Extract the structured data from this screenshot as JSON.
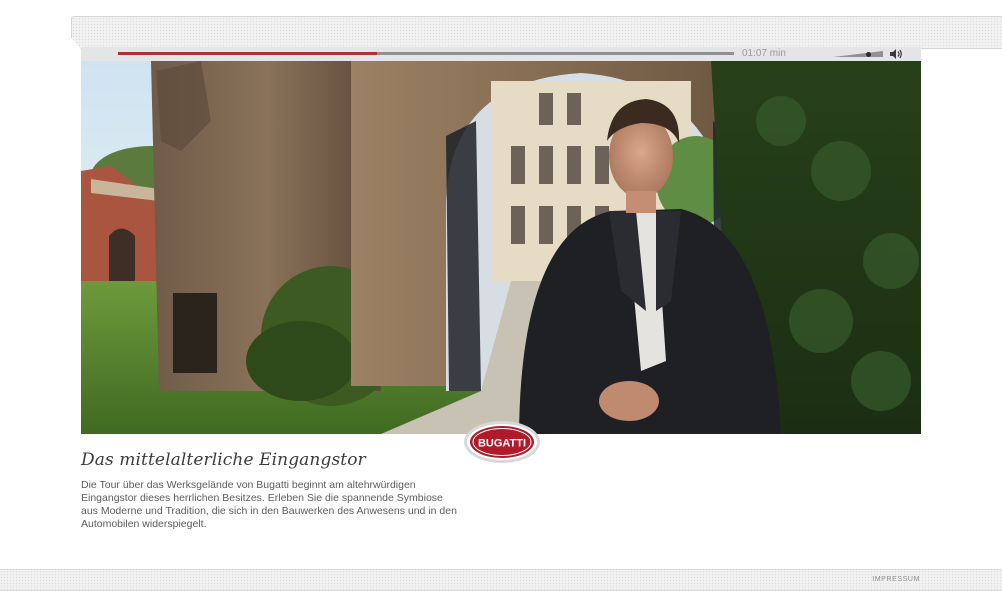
{
  "player": {
    "time": "01:07 min",
    "progress": 0.42,
    "volume": 0.7,
    "colors": {
      "progress": "#b03037",
      "track": "#8f9092",
      "bar": "#e4e5e6"
    }
  },
  "logo": {
    "text": "BUGATTI",
    "color": "#b11a2b"
  },
  "content": {
    "headline": "Das mittelalterliche Eingangstor",
    "description": "Die Tour über das Werksgelände von Bugatti beginnt am altehrwürdigen Eingangstor dieses herrlichen Besitzes. Erleben Sie die spannende Symbiose aus Moderne und Tradition, die sich in den Bauwerken des Anwesens und in den Automobilen widerspiegelt."
  },
  "footer": {
    "impressum": "IMPRESSUM"
  }
}
